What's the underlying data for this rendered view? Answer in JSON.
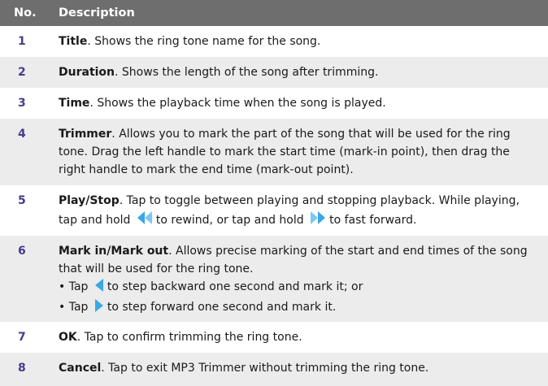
{
  "header": {
    "no": "No.",
    "description": "Description"
  },
  "rows": [
    {
      "no": "1",
      "term": "Title",
      "text": ". Shows the ring tone name for the song."
    },
    {
      "no": "2",
      "term": "Duration",
      "text": ". Shows the length of the song after trimming."
    },
    {
      "no": "3",
      "term": "Time",
      "text": ". Shows the playback time when the song is played."
    },
    {
      "no": "4",
      "term": "Trimmer",
      "text": ". Allows you to mark the part of the song that will be used for the ring tone. Drag the left handle to mark the start time (mark-in point), then drag the right handle to mark the end time (mark-out point)."
    },
    {
      "no": "5",
      "term": "Play/Stop",
      "text_a": ". Tap to toggle between playing and stopping playback. While playing, tap and hold",
      "text_b": "to rewind, or tap and hold",
      "text_c": "to fast forward."
    },
    {
      "no": "6",
      "term": "Mark in/Mark out",
      "text": ". Allows precise marking of the start and end times of the song that will be used for the ring tone.",
      "bullet1_a": "• Tap",
      "bullet1_b": "to step backward one second and mark it; or",
      "bullet2_a": "• Tap",
      "bullet2_b": "to step forward one second and mark it."
    },
    {
      "no": "7",
      "term": "OK",
      "text": ". Tap to confirm trimming the ring tone."
    },
    {
      "no": "8",
      "term": "Cancel",
      "text": ". Tap to exit MP3 Trimmer without trimming the ring tone."
    }
  ],
  "icons": {
    "rewind": "rewind-icon",
    "fast_forward": "fast-forward-icon",
    "step_back": "step-back-icon",
    "step_forward": "step-forward-icon"
  },
  "colors": {
    "header_bg": "#6e6e6e",
    "row_alt_bg": "#ececec",
    "number": "#4a3a8c",
    "icon": "#3aa8e6"
  }
}
